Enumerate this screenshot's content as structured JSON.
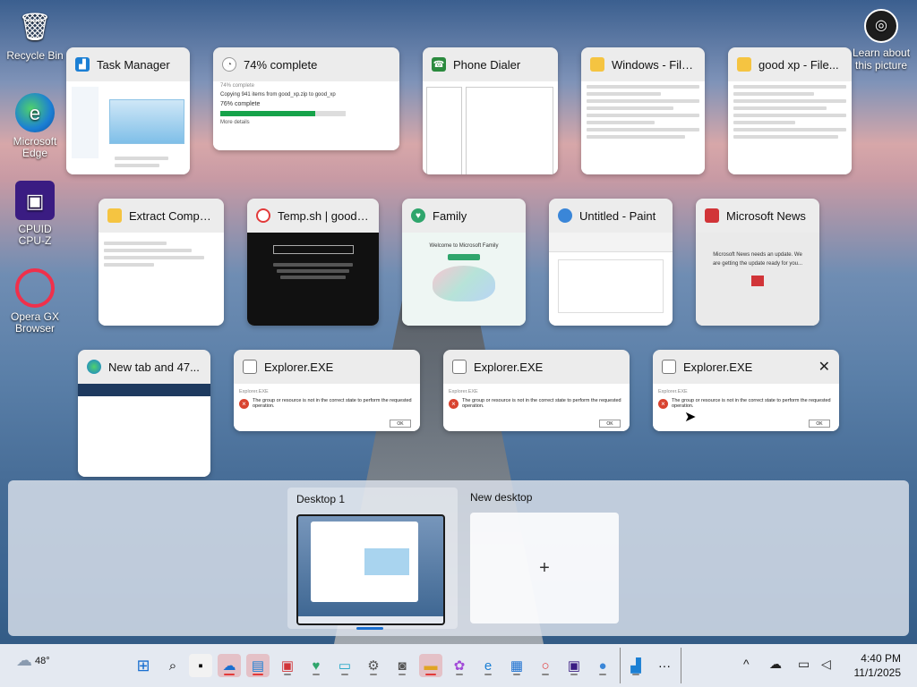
{
  "desktop": {
    "icons": [
      {
        "label": "Recycle Bin",
        "name": "recycle-bin-icon"
      },
      {
        "label": "Microsoft Edge",
        "name": "edge-icon"
      },
      {
        "label": "CPUID CPU-Z",
        "name": "cpuz-icon"
      },
      {
        "label": "Opera GX Browser",
        "name": "opera-gx-icon"
      }
    ],
    "learn_label": "Learn about this picture"
  },
  "windows": [
    {
      "title": "Task Manager",
      "icon": "task-manager-icon"
    },
    {
      "title": "74% complete",
      "icon": "progress-icon",
      "body": {
        "caption": "74% complete",
        "copy_line": "Copying 941 items from good_xp.zip to good_xp",
        "percent_text": "76% complete",
        "progress": 0.76,
        "more": "More details"
      }
    },
    {
      "title": "Phone Dialer",
      "icon": "phone-dialer-icon"
    },
    {
      "title": "Windows - File...",
      "icon": "folder-icon"
    },
    {
      "title": "good xp - File...",
      "icon": "folder-icon"
    },
    {
      "title": "Extract Compre...",
      "icon": "zip-folder-icon"
    },
    {
      "title": "Temp.sh | good_...",
      "icon": "opera-icon"
    },
    {
      "title": "Family",
      "icon": "family-icon",
      "body": {
        "heading": "Welcome to Microsoft Family"
      }
    },
    {
      "title": "Untitled - Paint",
      "icon": "paint-icon"
    },
    {
      "title": "Microsoft News",
      "icon": "news-icon",
      "body": {
        "line1": "Microsoft News needs an update. We",
        "line2": "are getting the update ready for you..."
      }
    },
    {
      "title": "New tab and 47...",
      "icon": "edge-icon"
    },
    {
      "title": "Explorer.EXE",
      "icon": "app-icon",
      "body": {
        "header": "Explorer.EXE",
        "message": "The group or resource is not in the correct state to perform the requested operation.",
        "ok": "OK"
      }
    },
    {
      "title": "Explorer.EXE",
      "icon": "app-icon",
      "body": {
        "header": "Explorer.EXE",
        "message": "The group or resource is not in the correct state to perform the requested operation.",
        "ok": "OK"
      }
    },
    {
      "title": "Explorer.EXE",
      "icon": "app-icon",
      "body": {
        "header": "Explorer.EXE",
        "message": "The group or resource is not in the correct state to perform the requested operation.",
        "ok": "OK"
      }
    }
  ],
  "virtual_desktops": {
    "desktop1": "Desktop 1",
    "new_desktop": "New desktop",
    "plus": "+"
  },
  "taskbar": {
    "weather_temp": "48°",
    "time": "4:40 PM",
    "date": "11/1/2025",
    "overflow": "···",
    "chevron": "^"
  },
  "colors": {
    "accent": "#1a6fd0",
    "error": "#d9432f",
    "progress": "#16a34a"
  }
}
